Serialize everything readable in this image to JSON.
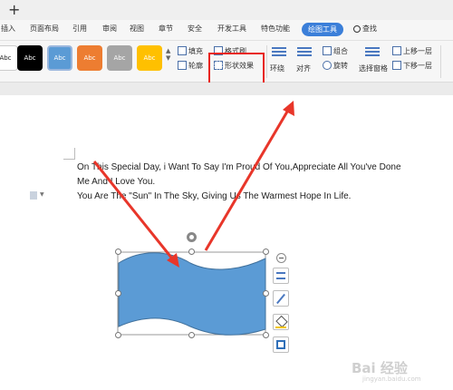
{
  "tabs": [
    {
      "label": "插入"
    },
    {
      "label": "页面布局"
    },
    {
      "label": "引用"
    },
    {
      "label": "审阅"
    },
    {
      "label": "视图"
    },
    {
      "label": "章节"
    },
    {
      "label": "安全"
    },
    {
      "label": "开发工具"
    },
    {
      "label": "特色功能"
    },
    {
      "label": "绘图工具"
    },
    {
      "label": "查找"
    }
  ],
  "ribbon": {
    "style_presets": [
      "Abc",
      "Abc",
      "Abc",
      "Abc",
      "Abc",
      "Abc"
    ],
    "fill": "填充",
    "format_painter": "格式刷",
    "outline": "轮廓",
    "shape_effects": "形状效果",
    "wrap": "环绕",
    "align": "对齐",
    "group": "组合",
    "rotate": "旋转",
    "selection_pane": "选择窗格",
    "bring_forward": "上移一层",
    "send_backward": "下移一层"
  },
  "document": {
    "lines": [
      "On This Special Day, i Want To Say I'm Proud Of You,Appreciate All You've Done",
      "Me And I Love You.",
      "You Are The \"Sun\" In The Sky, Giving Us The Warmest Hope In Life."
    ]
  },
  "colors": {
    "shape_fill": "#5b9bd5",
    "highlight": "#e8241c",
    "arrow": "#e8362a",
    "accent": "#3b7fd9"
  },
  "icons": [
    "plus-icon",
    "find-icon",
    "rotate-handle-icon",
    "layout-options-icon",
    "pen-icon",
    "fill-icon",
    "outline-icon",
    "collapse-icon"
  ],
  "watermark": {
    "text": "Bai 经验",
    "sub": "jingyan.baidu.com"
  }
}
